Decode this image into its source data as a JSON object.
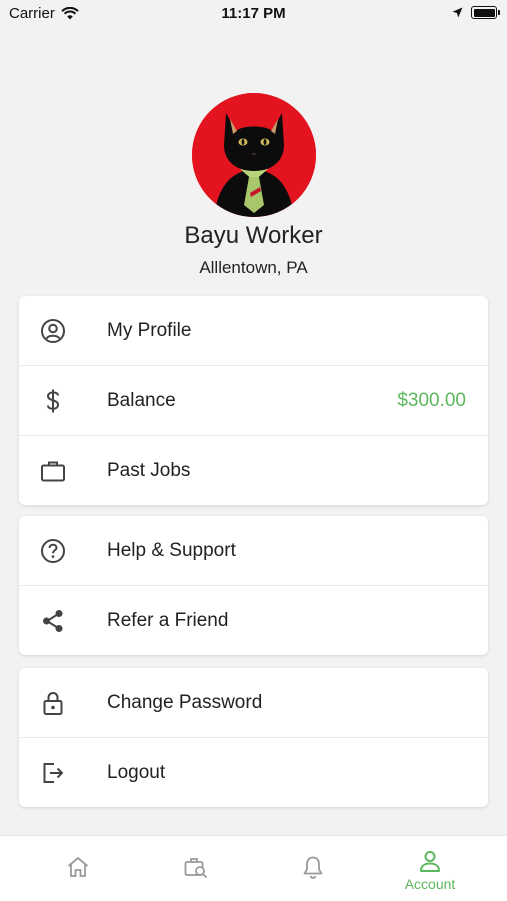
{
  "status_bar": {
    "carrier": "Carrier",
    "time": "11:17 PM"
  },
  "profile": {
    "name": "Bayu Worker",
    "location": "Alllentown, PA"
  },
  "menu_sections": [
    [
      {
        "label": "My Profile",
        "icon": "user-circle-icon"
      },
      {
        "label": "Balance",
        "icon": "dollar-icon",
        "value": "$300.00"
      },
      {
        "label": "Past Jobs",
        "icon": "briefcase-icon"
      }
    ],
    [
      {
        "label": "Help & Support",
        "icon": "question-circle-icon"
      },
      {
        "label": "Refer a Friend",
        "icon": "share-icon"
      }
    ],
    [
      {
        "label": "Change Password",
        "icon": "lock-icon"
      },
      {
        "label": "Logout",
        "icon": "logout-icon"
      }
    ]
  ],
  "tab_bar": {
    "tabs": [
      {
        "icon": "home-icon",
        "label": ""
      },
      {
        "icon": "search-jobs-icon",
        "label": ""
      },
      {
        "icon": "bell-icon",
        "label": ""
      },
      {
        "icon": "account-icon",
        "label": "Account",
        "active": true
      }
    ]
  },
  "colors": {
    "accent": "#5cb85c",
    "avatar_background": "#e3141f",
    "page_background": "#f2f2f2"
  }
}
